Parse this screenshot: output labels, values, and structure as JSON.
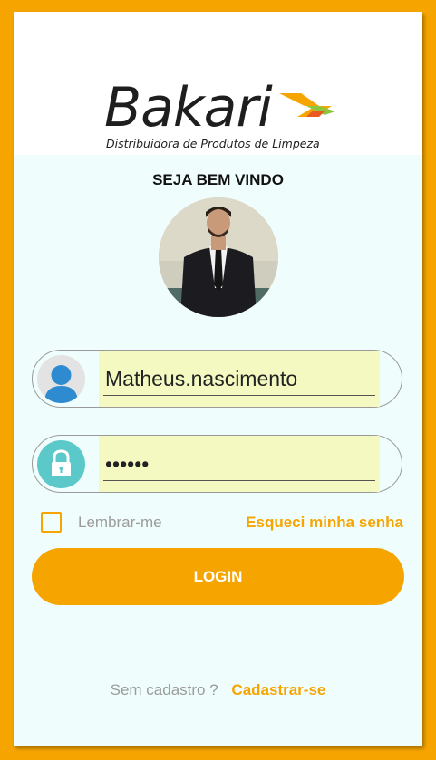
{
  "brand": {
    "name": "Bakari",
    "tagline": "Distribuidora de Produtos de Limpeza",
    "accent_color": "#f6a500"
  },
  "welcome": "SEJA BEM VINDO",
  "profile_photo": {
    "icon": "user-photo"
  },
  "username": {
    "icon": "user-icon",
    "value": "Matheus.nascimento"
  },
  "password": {
    "icon": "lock-icon",
    "value": "••••••"
  },
  "remember_label": "Lembrar-me",
  "forgot_label": "Esqueci minha senha",
  "login_label": "LOGIN",
  "signup": {
    "question": "Sem cadastro ?",
    "link": "Cadastrar-se"
  }
}
